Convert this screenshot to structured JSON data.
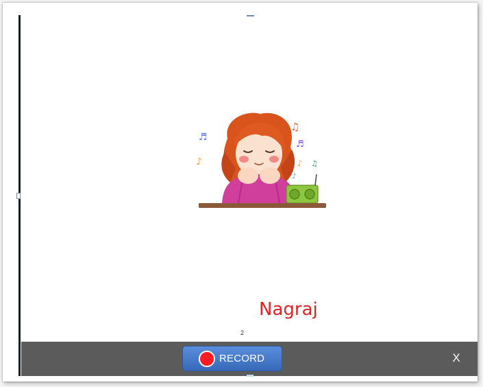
{
  "slide": {
    "name_text": "Nagraj",
    "page_number": "2",
    "name_color": "#e32323"
  },
  "toolbar": {
    "record_label": "RECORD",
    "close_label": "X",
    "background_color": "#5b5b5b",
    "record_button_color": "#4a7cc9",
    "record_dot_color": "#ff1d25"
  },
  "icons": {
    "record": "red-record-dot",
    "close": "x-close",
    "illustration": "girl-listening-to-music-with-radio"
  }
}
